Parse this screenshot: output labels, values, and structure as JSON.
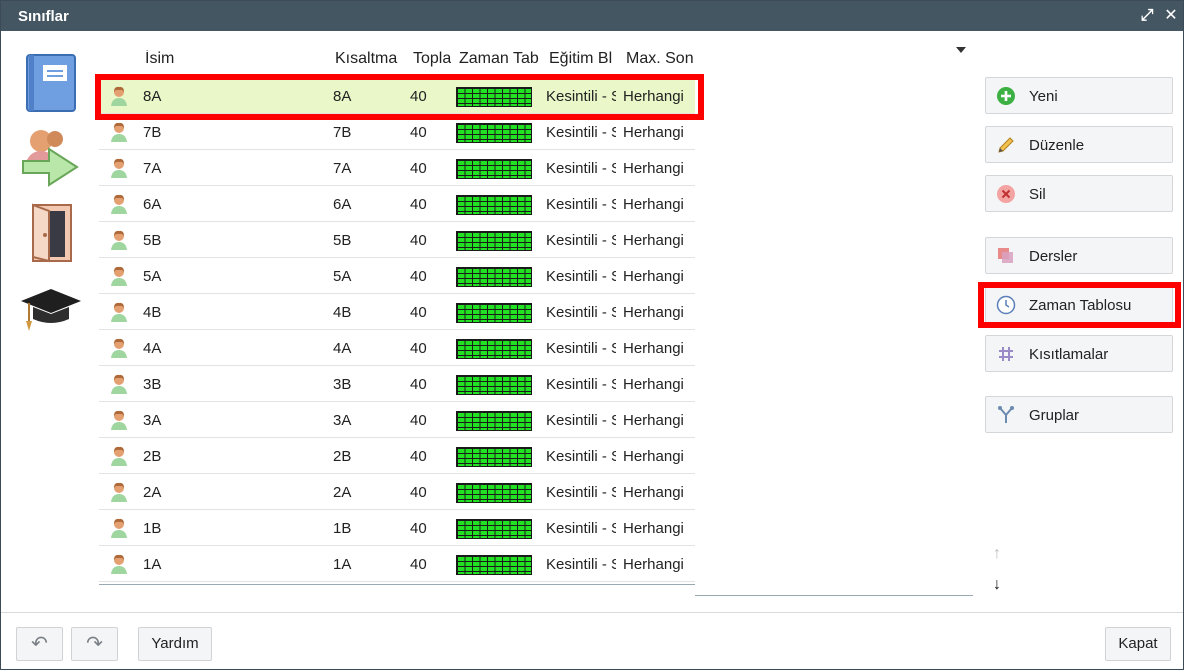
{
  "window": {
    "title": "Sınıflar"
  },
  "titlebar": {
    "maximize_icon": "⤢",
    "close_icon": "✕"
  },
  "left_icons": [
    "book-icon",
    "transfer-users-icon",
    "door-icon",
    "graduation-cap-icon"
  ],
  "columns": {
    "name": "İsim",
    "abbr": "Kısaltma",
    "total": "Topla",
    "timetable": "Zaman Tab",
    "block": "Eğitim Bl",
    "max": "Max. Son"
  },
  "rows": [
    {
      "name": "8A",
      "abbr": "8A",
      "total": "40",
      "block": "Kesintili - S",
      "max": "Herhangi"
    },
    {
      "name": "7B",
      "abbr": "7B",
      "total": "40",
      "block": "Kesintili - S",
      "max": "Herhangi"
    },
    {
      "name": "7A",
      "abbr": "7A",
      "total": "40",
      "block": "Kesintili - S",
      "max": "Herhangi"
    },
    {
      "name": "6A",
      "abbr": "6A",
      "total": "40",
      "block": "Kesintili - S",
      "max": "Herhangi"
    },
    {
      "name": "5B",
      "abbr": "5B",
      "total": "40",
      "block": "Kesintili - S",
      "max": "Herhangi"
    },
    {
      "name": "5A",
      "abbr": "5A",
      "total": "40",
      "block": "Kesintili - S",
      "max": "Herhangi"
    },
    {
      "name": "4B",
      "abbr": "4B",
      "total": "40",
      "block": "Kesintili - S",
      "max": "Herhangi"
    },
    {
      "name": "4A",
      "abbr": "4A",
      "total": "40",
      "block": "Kesintili - S",
      "max": "Herhangi"
    },
    {
      "name": "3B",
      "abbr": "3B",
      "total": "40",
      "block": "Kesintili - S",
      "max": "Herhangi"
    },
    {
      "name": "3A",
      "abbr": "3A",
      "total": "40",
      "block": "Kesintili - S",
      "max": "Herhangi"
    },
    {
      "name": "2B",
      "abbr": "2B",
      "total": "40",
      "block": "Kesintili - S",
      "max": "Herhangi"
    },
    {
      "name": "2A",
      "abbr": "2A",
      "total": "40",
      "block": "Kesintili - S",
      "max": "Herhangi"
    },
    {
      "name": "1B",
      "abbr": "1B",
      "total": "40",
      "block": "Kesintili - S",
      "max": "Herhangi"
    },
    {
      "name": "1A",
      "abbr": "1A",
      "total": "40",
      "block": "Kesintili - S",
      "max": "Herhangi"
    }
  ],
  "selected_row": 0,
  "side_buttons": {
    "new": "Yeni",
    "edit": "Düzenle",
    "delete": "Sil",
    "lessons": "Dersler",
    "timetable": "Zaman Tablosu",
    "constraints": "Kısıtlamalar",
    "groups": "Gruplar"
  },
  "nav": {
    "up": "↑",
    "down": "↓"
  },
  "footer": {
    "undo": "↶",
    "redo": "↷",
    "help": "Yardım",
    "close": "Kapat"
  },
  "colors": {
    "titlebar": "#455663",
    "selected_row": "#eaf7c8",
    "timetable_fill": "#22e022",
    "highlight": "#ff0000"
  }
}
